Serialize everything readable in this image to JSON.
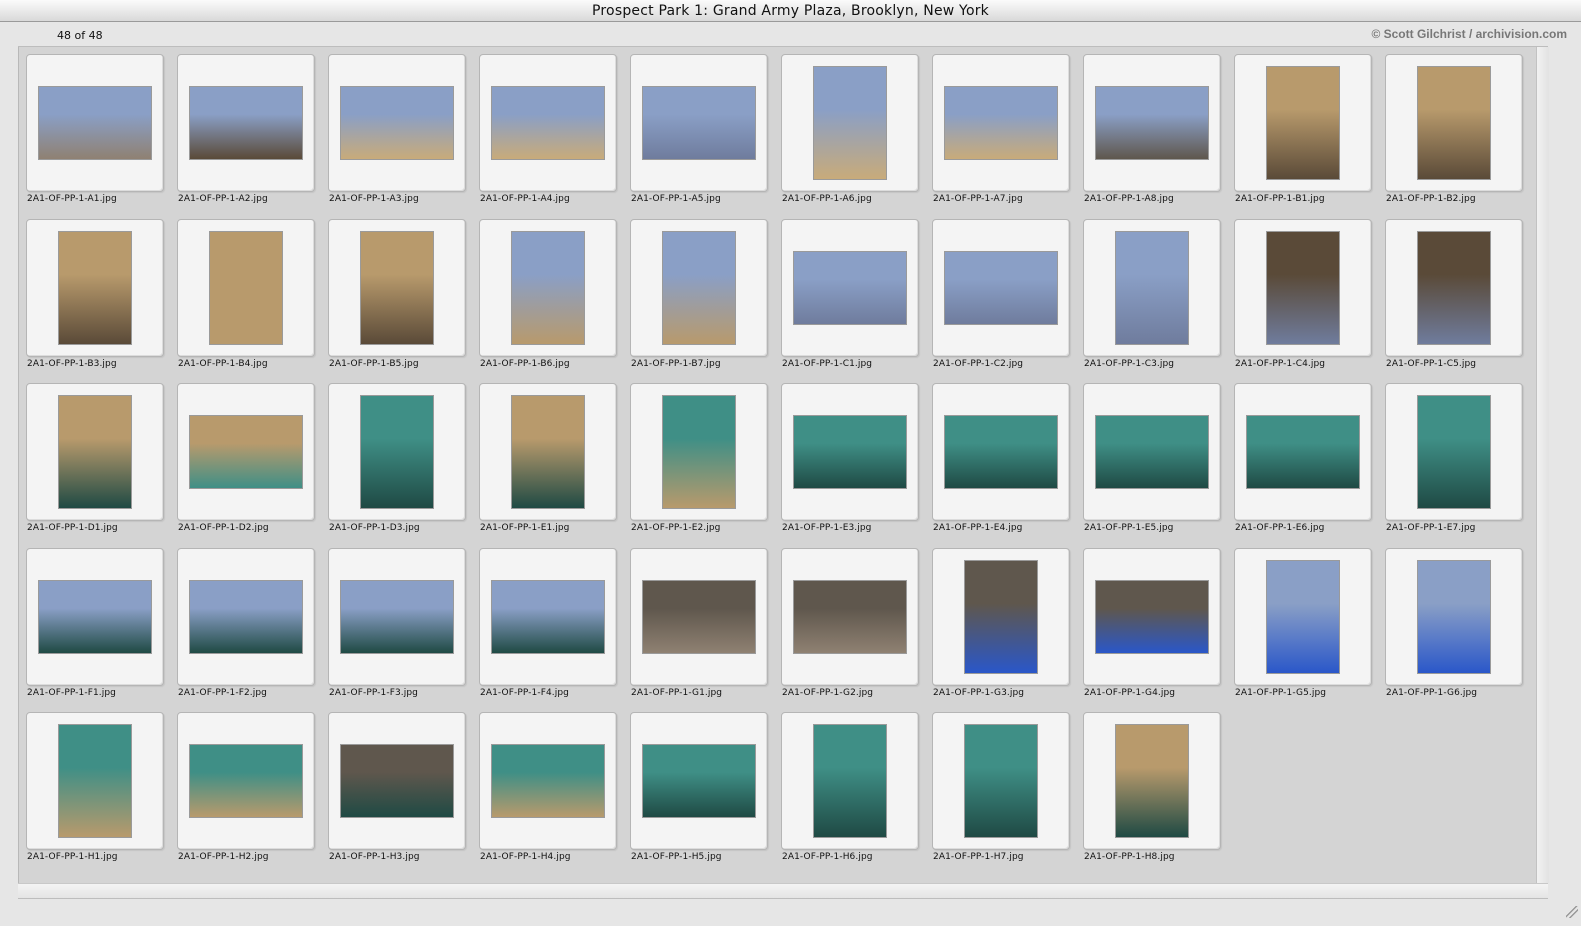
{
  "window": {
    "title": "Prospect Park 1: Grand Army Plaza, Brooklyn, New York"
  },
  "status": {
    "count": "48 of 48",
    "credit": "© Scott Gilchrist / archivision.com"
  },
  "palette": {
    "sky": "#8a9fc6",
    "pavement": "#8f8172",
    "sand": "#c8ab7a",
    "stone": "#b89a6c",
    "stone_dark": "#5a4a38",
    "bronze": "#3f8f86",
    "bronze_dark": "#1f4a44",
    "water": "#2a57c9",
    "trees": "#5f574d",
    "dusk": "#6f7c9d"
  },
  "images": [
    {
      "file": "2A1-OF-PP-1-A1.jpg",
      "orientation": "land",
      "top": "sky",
      "bottom": "pavement"
    },
    {
      "file": "2A1-OF-PP-1-A2.jpg",
      "orientation": "land",
      "top": "sky",
      "bottom": "stone_dark"
    },
    {
      "file": "2A1-OF-PP-1-A3.jpg",
      "orientation": "land",
      "top": "sky",
      "bottom": "sand"
    },
    {
      "file": "2A1-OF-PP-1-A4.jpg",
      "orientation": "land",
      "top": "sky",
      "bottom": "sand"
    },
    {
      "file": "2A1-OF-PP-1-A5.jpg",
      "orientation": "land",
      "top": "sky",
      "bottom": "dusk"
    },
    {
      "file": "2A1-OF-PP-1-A6.jpg",
      "orientation": "port",
      "top": "sky",
      "bottom": "sand"
    },
    {
      "file": "2A1-OF-PP-1-A7.jpg",
      "orientation": "land",
      "top": "sky",
      "bottom": "sand"
    },
    {
      "file": "2A1-OF-PP-1-A8.jpg",
      "orientation": "land",
      "top": "sky",
      "bottom": "trees"
    },
    {
      "file": "2A1-OF-PP-1-B1.jpg",
      "orientation": "port",
      "top": "stone",
      "bottom": "stone_dark"
    },
    {
      "file": "2A1-OF-PP-1-B2.jpg",
      "orientation": "port",
      "top": "stone",
      "bottom": "stone_dark"
    },
    {
      "file": "2A1-OF-PP-1-B3.jpg",
      "orientation": "port",
      "top": "stone",
      "bottom": "stone_dark"
    },
    {
      "file": "2A1-OF-PP-1-B4.jpg",
      "orientation": "port",
      "top": "stone",
      "bottom": "stone"
    },
    {
      "file": "2A1-OF-PP-1-B5.jpg",
      "orientation": "port",
      "top": "stone",
      "bottom": "stone_dark"
    },
    {
      "file": "2A1-OF-PP-1-B6.jpg",
      "orientation": "port",
      "top": "sky",
      "bottom": "stone"
    },
    {
      "file": "2A1-OF-PP-1-B7.jpg",
      "orientation": "port",
      "top": "sky",
      "bottom": "stone"
    },
    {
      "file": "2A1-OF-PP-1-C1.jpg",
      "orientation": "land",
      "top": "sky",
      "bottom": "dusk"
    },
    {
      "file": "2A1-OF-PP-1-C2.jpg",
      "orientation": "land",
      "top": "sky",
      "bottom": "dusk"
    },
    {
      "file": "2A1-OF-PP-1-C3.jpg",
      "orientation": "port",
      "top": "sky",
      "bottom": "dusk"
    },
    {
      "file": "2A1-OF-PP-1-C4.jpg",
      "orientation": "port",
      "top": "stone_dark",
      "bottom": "dusk"
    },
    {
      "file": "2A1-OF-PP-1-C5.jpg",
      "orientation": "port",
      "top": "stone_dark",
      "bottom": "dusk"
    },
    {
      "file": "2A1-OF-PP-1-D1.jpg",
      "orientation": "port",
      "top": "stone",
      "bottom": "bronze_dark"
    },
    {
      "file": "2A1-OF-PP-1-D2.jpg",
      "orientation": "land",
      "top": "stone",
      "bottom": "bronze"
    },
    {
      "file": "2A1-OF-PP-1-D3.jpg",
      "orientation": "port",
      "top": "bronze",
      "bottom": "bronze_dark"
    },
    {
      "file": "2A1-OF-PP-1-E1.jpg",
      "orientation": "port",
      "top": "stone",
      "bottom": "bronze_dark"
    },
    {
      "file": "2A1-OF-PP-1-E2.jpg",
      "orientation": "port",
      "top": "bronze",
      "bottom": "stone"
    },
    {
      "file": "2A1-OF-PP-1-E3.jpg",
      "orientation": "land",
      "top": "bronze",
      "bottom": "bronze_dark"
    },
    {
      "file": "2A1-OF-PP-1-E4.jpg",
      "orientation": "land",
      "top": "bronze",
      "bottom": "bronze_dark"
    },
    {
      "file": "2A1-OF-PP-1-E5.jpg",
      "orientation": "land",
      "top": "bronze",
      "bottom": "bronze_dark"
    },
    {
      "file": "2A1-OF-PP-1-E6.jpg",
      "orientation": "land",
      "top": "bronze",
      "bottom": "bronze_dark"
    },
    {
      "file": "2A1-OF-PP-1-E7.jpg",
      "orientation": "port",
      "top": "bronze",
      "bottom": "bronze_dark"
    },
    {
      "file": "2A1-OF-PP-1-F1.jpg",
      "orientation": "land",
      "top": "sky",
      "bottom": "bronze_dark"
    },
    {
      "file": "2A1-OF-PP-1-F2.jpg",
      "orientation": "land",
      "top": "sky",
      "bottom": "bronze_dark"
    },
    {
      "file": "2A1-OF-PP-1-F3.jpg",
      "orientation": "land",
      "top": "sky",
      "bottom": "bronze_dark"
    },
    {
      "file": "2A1-OF-PP-1-F4.jpg",
      "orientation": "land",
      "top": "sky",
      "bottom": "bronze_dark"
    },
    {
      "file": "2A1-OF-PP-1-G1.jpg",
      "orientation": "land",
      "top": "trees",
      "bottom": "pavement"
    },
    {
      "file": "2A1-OF-PP-1-G2.jpg",
      "orientation": "land",
      "top": "trees",
      "bottom": "pavement"
    },
    {
      "file": "2A1-OF-PP-1-G3.jpg",
      "orientation": "port",
      "top": "trees",
      "bottom": "water"
    },
    {
      "file": "2A1-OF-PP-1-G4.jpg",
      "orientation": "land",
      "top": "trees",
      "bottom": "water"
    },
    {
      "file": "2A1-OF-PP-1-G5.jpg",
      "orientation": "port",
      "top": "sky",
      "bottom": "water"
    },
    {
      "file": "2A1-OF-PP-1-G6.jpg",
      "orientation": "port",
      "top": "sky",
      "bottom": "water"
    },
    {
      "file": "2A1-OF-PP-1-H1.jpg",
      "orientation": "port",
      "top": "bronze",
      "bottom": "stone"
    },
    {
      "file": "2A1-OF-PP-1-H2.jpg",
      "orientation": "land",
      "top": "bronze",
      "bottom": "stone"
    },
    {
      "file": "2A1-OF-PP-1-H3.jpg",
      "orientation": "land",
      "top": "trees",
      "bottom": "bronze_dark"
    },
    {
      "file": "2A1-OF-PP-1-H4.jpg",
      "orientation": "land",
      "top": "bronze",
      "bottom": "stone"
    },
    {
      "file": "2A1-OF-PP-1-H5.jpg",
      "orientation": "land",
      "top": "bronze",
      "bottom": "bronze_dark"
    },
    {
      "file": "2A1-OF-PP-1-H6.jpg",
      "orientation": "port",
      "top": "bronze",
      "bottom": "bronze_dark"
    },
    {
      "file": "2A1-OF-PP-1-H7.jpg",
      "orientation": "port",
      "top": "bronze",
      "bottom": "bronze_dark"
    },
    {
      "file": "2A1-OF-PP-1-H8.jpg",
      "orientation": "port",
      "top": "stone",
      "bottom": "bronze_dark"
    }
  ]
}
